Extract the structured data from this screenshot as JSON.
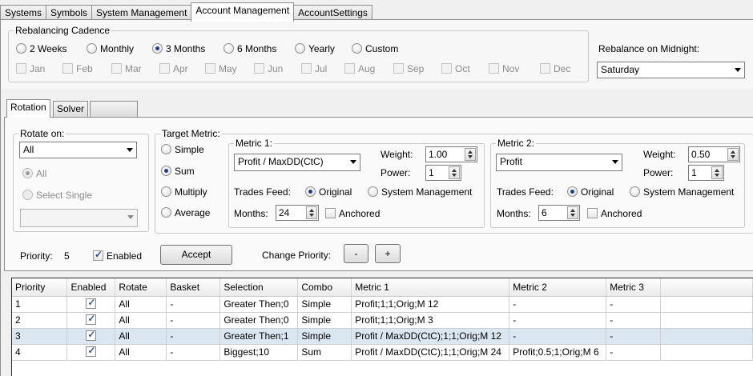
{
  "top_tabs": [
    "Systems",
    "Symbols",
    "System Management",
    "Account Management",
    "AccountSettings"
  ],
  "active_top_tab": "Account Management",
  "cadence": {
    "legend": "Rebalancing Cadence",
    "options": [
      "2 Weeks",
      "Monthly",
      "3 Months",
      "6 Months",
      "Yearly",
      "Custom"
    ],
    "selected": "3 Months",
    "months": [
      "Jan",
      "Feb",
      "Mar",
      "Apr",
      "May",
      "Jun",
      "Jul",
      "Aug",
      "Sep",
      "Oct",
      "Nov",
      "Dec"
    ]
  },
  "midnight": {
    "label": "Rebalance on Midnight:",
    "value": "Saturday"
  },
  "inner_tabs": [
    "Rotation",
    "Solver",
    ""
  ],
  "rotate_on": {
    "legend": "Rotate on:",
    "value": "All",
    "all_label": "All",
    "select_single_label": "Select Single"
  },
  "target_metric": {
    "legend": "Target Metric:",
    "options": [
      "Simple",
      "Sum",
      "Multiply",
      "Average"
    ],
    "selected": "Sum"
  },
  "metric1": {
    "legend": "Metric 1:",
    "value": "Profit / MaxDD(CtC)",
    "weight_label": "Weight:",
    "weight": "1.00",
    "power_label": "Power:",
    "power": "1",
    "feed_label": "Trades Feed:",
    "feed_original": "Original",
    "feed_system": "System Management",
    "months_label": "Months:",
    "months": "24",
    "anchored": "Anchored"
  },
  "metric2": {
    "legend": "Metric 2:",
    "value": "Profit",
    "weight_label": "Weight:",
    "weight": "0.50",
    "power_label": "Power:",
    "power": "1",
    "feed_label": "Trades Feed:",
    "feed_original": "Original",
    "feed_system": "System Management",
    "months_label": "Months:",
    "months": "6",
    "anchored": "Anchored"
  },
  "priority": {
    "label": "Priority:",
    "value": "5",
    "enabled_label": "Enabled",
    "accept": "Accept",
    "change_label": "Change Priority:",
    "minus": "-",
    "plus": "+"
  },
  "grid": {
    "columns": [
      "Priority",
      "Enabled",
      "Rotate",
      "Basket",
      "Selection",
      "Combo",
      "Metric 1",
      "Metric 2",
      "Metric 3"
    ],
    "rows": [
      [
        "1",
        "",
        "All",
        "-",
        "Greater Then;0",
        "Simple",
        "Profit;1;1;Orig;M 12",
        "-",
        "-"
      ],
      [
        "2",
        "",
        "All",
        "-",
        "Greater Then;0",
        "Simple",
        "Profit;1;1;Orig;M 3",
        "-",
        "-"
      ],
      [
        "3",
        "",
        "All",
        "-",
        "Greater Then;1",
        "Simple",
        "Profit / MaxDD(CtC);1;1;Orig;M 12",
        "-",
        "-"
      ],
      [
        "4",
        "",
        "All",
        "-",
        "Biggest;10",
        "Sum",
        "Profit / MaxDD(CtC);1;1;Orig;M 24",
        "Profit;0.5;1;Orig;M 6",
        "-"
      ]
    ],
    "selected_row": 2
  }
}
